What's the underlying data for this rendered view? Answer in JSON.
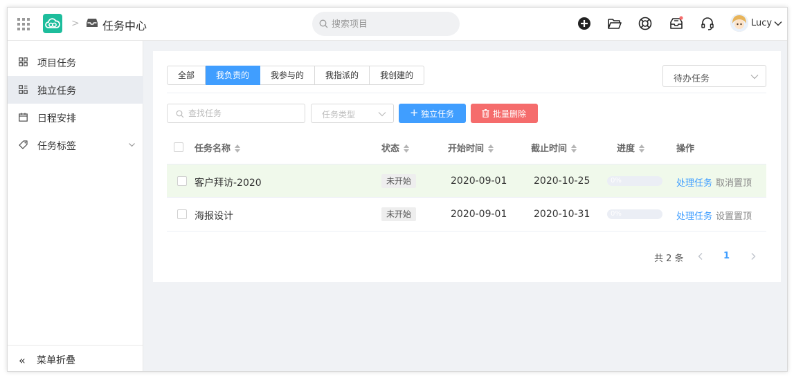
{
  "header": {
    "title": "任务中心",
    "search_placeholder": "搜索项目",
    "user_name": "Lucy",
    "icons": [
      "add-circle-icon",
      "folder-open-icon",
      "lifebuoy-icon",
      "inbox-notification-icon",
      "headset-icon"
    ]
  },
  "sidebar": {
    "items": [
      {
        "label": "项目任务",
        "icon": "grid-icon"
      },
      {
        "label": "独立任务",
        "icon": "layout-icon",
        "active": true
      },
      {
        "label": "日程安排",
        "icon": "calendar-icon"
      },
      {
        "label": "任务标签",
        "icon": "tag-icon",
        "expandable": true
      }
    ],
    "collapse_label": "菜单折叠"
  },
  "tabs": [
    {
      "label": "全部"
    },
    {
      "label": "我负责的",
      "active": true
    },
    {
      "label": "我参与的"
    },
    {
      "label": "我指派的"
    },
    {
      "label": "我创建的"
    }
  ],
  "filter": {
    "selected": "待办任务"
  },
  "toolbar": {
    "search_placeholder": "查找任务",
    "type_placeholder": "任务类型",
    "add_label": "独立任务",
    "delete_label": "批量删除"
  },
  "table": {
    "columns": {
      "name": "任务名称",
      "status": "状态",
      "start": "开始时间",
      "end": "截止时间",
      "progress": "进度",
      "actions": "操作"
    },
    "rows": [
      {
        "name": "客户拜访-2020",
        "status": "未开始",
        "start": "2020-09-01",
        "end": "2020-10-25",
        "progress": "0%",
        "progress_value": 0,
        "action_primary": "处理任务",
        "action_secondary": "取消置顶",
        "highlight": true
      },
      {
        "name": "海报设计",
        "status": "未开始",
        "start": "2020-09-01",
        "end": "2020-10-31",
        "progress": "0%",
        "progress_value": 0,
        "action_primary": "处理任务",
        "action_secondary": "设置置顶",
        "highlight": false
      }
    ]
  },
  "pagination": {
    "total": "共 2 条",
    "current": "1"
  },
  "colors": {
    "primary": "#409eff",
    "danger": "#f56c6c",
    "logo": "#1dbd9c",
    "row_highlight": "#f0f9eb"
  }
}
